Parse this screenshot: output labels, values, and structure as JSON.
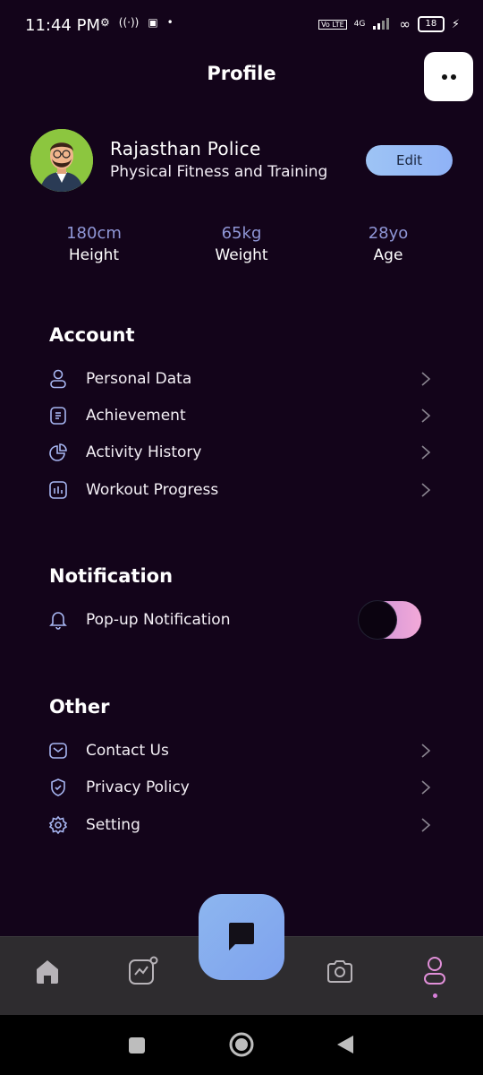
{
  "status_bar": {
    "time": "11:44 PM",
    "network": "4G",
    "volte": "Vo LTE",
    "battery": "18"
  },
  "header": {
    "title": "Profile"
  },
  "profile": {
    "name": "Rajasthan Police",
    "program": "Physical Fitness and Training",
    "edit_label": "Edit"
  },
  "stats": [
    {
      "value": "180cm",
      "label": "Height"
    },
    {
      "value": "65kg",
      "label": "Weight"
    },
    {
      "value": "28yo",
      "label": "Age"
    }
  ],
  "account": {
    "title": "Account",
    "items": [
      {
        "label": "Personal Data",
        "icon": "user-icon"
      },
      {
        "label": "Achievement",
        "icon": "document-icon"
      },
      {
        "label": "Activity History",
        "icon": "pie-chart-icon"
      },
      {
        "label": "Workout Progress",
        "icon": "bar-chart-icon"
      }
    ]
  },
  "notification": {
    "title": "Notification",
    "item_label": "Pop-up Notification",
    "toggle_on": false
  },
  "other": {
    "title": "Other",
    "items": [
      {
        "label": "Contact Us",
        "icon": "mail-icon"
      },
      {
        "label": "Privacy Policy",
        "icon": "shield-icon"
      },
      {
        "label": "Setting",
        "icon": "gear-icon"
      }
    ]
  },
  "colors": {
    "background": "#13041a",
    "accent_blue": "#8fb2f6",
    "accent_pink": "#f3a9d8",
    "stat_value": "#8f96d6"
  },
  "bottom_nav": {
    "items": [
      "home-icon",
      "activity-chart-icon",
      "chat-icon",
      "camera-icon",
      "profile-icon"
    ],
    "active": "profile-icon"
  }
}
